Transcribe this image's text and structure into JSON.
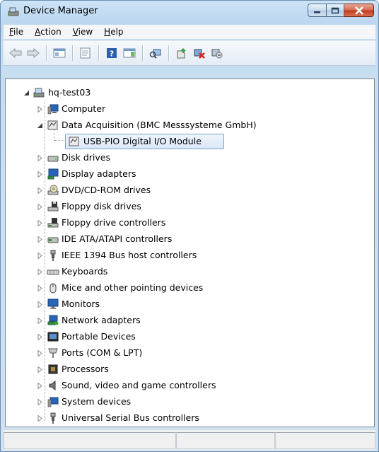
{
  "window": {
    "title": "Device Manager",
    "app_icon": "device-manager-icon"
  },
  "caption_buttons": [
    {
      "name": "minimize-button",
      "glyph": "—"
    },
    {
      "name": "maximize-button",
      "glyph": "☐"
    },
    {
      "name": "close-button",
      "glyph": "✕"
    }
  ],
  "menu": [
    {
      "label_prefix": "",
      "accel": "F",
      "label_rest": "ile"
    },
    {
      "label_prefix": "",
      "accel": "A",
      "label_rest": "ction"
    },
    {
      "label_prefix": "",
      "accel": "V",
      "label_rest": "iew"
    },
    {
      "label_prefix": "",
      "accel": "H",
      "label_rest": "elp"
    }
  ],
  "toolbar": [
    "back-icon",
    "forward-icon",
    "separator",
    "show-hide-console-tree-icon",
    "separator",
    "properties-icon",
    "separator",
    "help-icon",
    "show-hide-action-pane-icon",
    "separator",
    "scan-hardware-icon",
    "separator",
    "update-driver-icon",
    "uninstall-icon",
    "disable-device-icon"
  ],
  "tree": {
    "root": {
      "label": "hq-test03",
      "icon": "computer-root-icon",
      "expanded": true
    },
    "nodes": [
      {
        "label": "Computer",
        "icon": "computer-icon",
        "expanded": false
      },
      {
        "label": "Data Acquisition (BMC Messsysteme GmbH)",
        "icon": "data-acquisition-icon",
        "expanded": true,
        "children": [
          {
            "label": "USB-PIO Digital I/O Module",
            "icon": "io-module-icon",
            "selected": true
          }
        ]
      },
      {
        "label": "Disk drives",
        "icon": "disk-drive-icon",
        "expanded": false
      },
      {
        "label": "Display adapters",
        "icon": "display-adapter-icon",
        "expanded": false
      },
      {
        "label": "DVD/CD-ROM drives",
        "icon": "dvd-drive-icon",
        "expanded": false
      },
      {
        "label": "Floppy disk drives",
        "icon": "floppy-disk-icon",
        "expanded": false
      },
      {
        "label": "Floppy drive controllers",
        "icon": "floppy-controller-icon",
        "expanded": false
      },
      {
        "label": "IDE ATA/ATAPI controllers",
        "icon": "ide-controller-icon",
        "expanded": false
      },
      {
        "label": "IEEE 1394 Bus host controllers",
        "icon": "firewire-icon",
        "expanded": false
      },
      {
        "label": "Keyboards",
        "icon": "keyboard-icon",
        "expanded": false
      },
      {
        "label": "Mice and other pointing devices",
        "icon": "mouse-icon",
        "expanded": false
      },
      {
        "label": "Monitors",
        "icon": "monitor-icon",
        "expanded": false
      },
      {
        "label": "Network adapters",
        "icon": "network-adapter-icon",
        "expanded": false
      },
      {
        "label": "Portable Devices",
        "icon": "portable-device-icon",
        "expanded": false
      },
      {
        "label": "Ports (COM & LPT)",
        "icon": "port-icon",
        "expanded": false
      },
      {
        "label": "Processors",
        "icon": "processor-icon",
        "expanded": false
      },
      {
        "label": "Sound, video and game controllers",
        "icon": "sound-icon",
        "expanded": false
      },
      {
        "label": "System devices",
        "icon": "system-device-icon",
        "expanded": false
      },
      {
        "label": "Universal Serial Bus controllers",
        "icon": "usb-icon",
        "expanded": false
      }
    ]
  },
  "status": {
    "pane1": "",
    "pane2": "",
    "pane3": ""
  },
  "colors": {
    "selection_border": "#7da2ce",
    "selection_fill": "#dbe8f8",
    "close_red": "#c0391a"
  }
}
